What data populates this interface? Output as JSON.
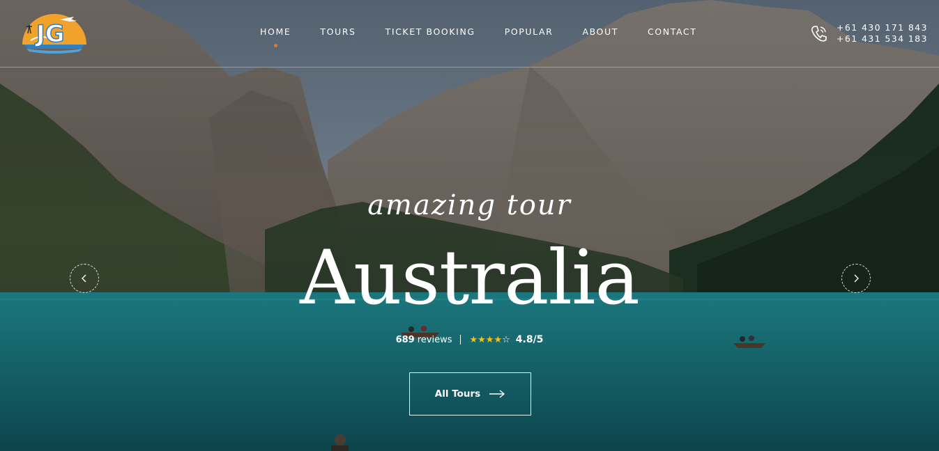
{
  "brand": {
    "logo_letters": "JG"
  },
  "nav": {
    "items": [
      {
        "label": "HOME",
        "active": true
      },
      {
        "label": "TOURS",
        "active": false
      },
      {
        "label": "TICKET BOOKING",
        "active": false
      },
      {
        "label": "POPULAR",
        "active": false
      },
      {
        "label": "ABOUT",
        "active": false
      },
      {
        "label": "CONTACT",
        "active": false
      }
    ]
  },
  "contact": {
    "icon": "phone-icon",
    "phones": [
      "+61 430 171 843",
      "+61 431 534 183"
    ]
  },
  "hero": {
    "script_title": "amazing tour",
    "title": "Australia",
    "reviews_count": "689",
    "reviews_label": "reviews",
    "rating_stars": 4,
    "rating_max": 5,
    "rating_text": "4.8/5",
    "cta_label": "All Tours",
    "prev_icon": "chevron-left-icon",
    "next_icon": "chevron-right-icon"
  },
  "colors": {
    "accent": "#e8762d",
    "star": "#f3c317",
    "water": "#1f7f86"
  }
}
